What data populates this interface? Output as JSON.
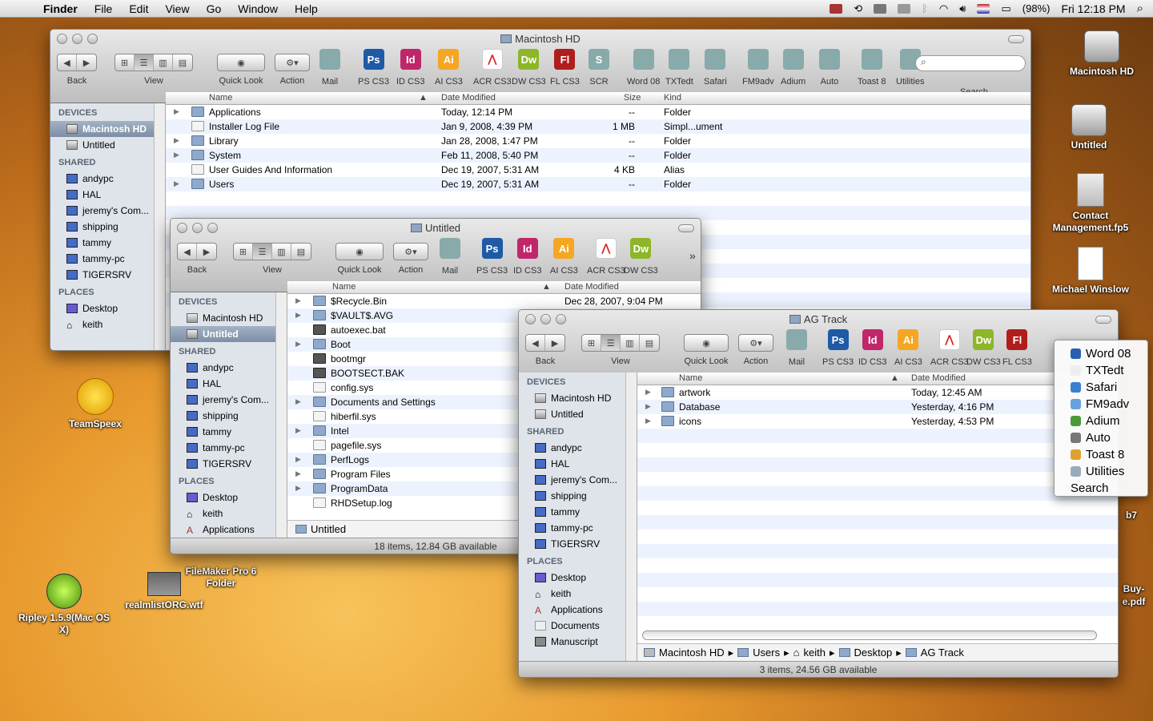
{
  "menubar": {
    "app": "Finder",
    "items": [
      "File",
      "Edit",
      "View",
      "Go",
      "Window",
      "Help"
    ],
    "battery": "(98%)",
    "clock": "Fri 12:18 PM"
  },
  "desktop": {
    "icons": [
      {
        "label": "Macintosh HD",
        "icon": "hard-drive-icon"
      },
      {
        "label": "Untitled",
        "icon": "hard-drive-icon"
      },
      {
        "label": "Contact Management.fp5",
        "icon": "filemaker-doc-icon"
      },
      {
        "label": "Michael Winslow",
        "icon": "rtf-doc-icon"
      },
      {
        "label": "TeamSpeex",
        "icon": "smiley-app-icon"
      },
      {
        "label": "FileMaker Pro 6 Folder",
        "icon": "folder-icon"
      },
      {
        "label": "Ripley 1.5.9(Mac OS X)",
        "icon": "alien-app-icon"
      },
      {
        "label": "realmlistORG.wtf",
        "icon": "document-icon"
      }
    ],
    "partial": {
      "b7": "b7",
      "buy": "Buy-",
      "pdf": "e.pdf"
    }
  },
  "common": {
    "back": "Back",
    "view": "View",
    "quicklook": "Quick Look",
    "action": "Action",
    "search": "Search"
  },
  "sidebar": {
    "devices": "DEVICES",
    "shared": "SHARED",
    "places": "PLACES",
    "device_items": [
      "Macintosh HD",
      "Untitled"
    ],
    "shared_items": [
      "andypc",
      "HAL",
      "jeremy's Com...",
      "shipping",
      "tammy",
      "tammy-pc",
      "TIGERSRV"
    ],
    "places_w1": [
      "Desktop",
      "keith"
    ],
    "places_w2": [
      "Desktop",
      "keith",
      "Applications"
    ],
    "places_w3": [
      "Desktop",
      "keith",
      "Applications",
      "Documents",
      "Manuscript"
    ]
  },
  "win1": {
    "title": "Macintosh HD",
    "tools": [
      "Mail",
      "PS CS3",
      "ID CS3",
      "AI CS3",
      "ACR CS3",
      "DW CS3",
      "FL CS3",
      "SCR",
      "Word 08",
      "TXTedt",
      "Safari",
      "FM9adv",
      "Adium",
      "Auto",
      "Toast 8",
      "Utilities"
    ],
    "columns": {
      "name": "Name",
      "date": "Date Modified",
      "size": "Size",
      "kind": "Kind"
    },
    "rows": [
      {
        "name": "Applications",
        "date": "Today, 12:14 PM",
        "size": "--",
        "kind": "Folder"
      },
      {
        "name": "Installer Log File",
        "date": "Jan 9, 2008, 4:39 PM",
        "size": "1 MB",
        "kind": "Simpl...ument"
      },
      {
        "name": "Library",
        "date": "Jan 28, 2008, 1:47 PM",
        "size": "--",
        "kind": "Folder"
      },
      {
        "name": "System",
        "date": "Feb 11, 2008, 5:40 PM",
        "size": "--",
        "kind": "Folder"
      },
      {
        "name": "User Guides And Information",
        "date": "Dec 19, 2007, 5:31 AM",
        "size": "4 KB",
        "kind": "Alias"
      },
      {
        "name": "Users",
        "date": "Dec 19, 2007, 5:31 AM",
        "size": "--",
        "kind": "Folder"
      }
    ]
  },
  "win2": {
    "title": "Untitled",
    "tools": [
      "Mail",
      "PS CS3",
      "ID CS3",
      "AI CS3",
      "ACR CS3",
      "DW CS3"
    ],
    "columns": {
      "name": "Name",
      "date": "Date Modified"
    },
    "rows": [
      "$Recycle.Bin",
      "$VAULT$.AVG",
      "autoexec.bat",
      "Boot",
      "bootmgr",
      "BOOTSECT.BAK",
      "config.sys",
      "Documents and Settings",
      "hiberfil.sys",
      "Intel",
      "pagefile.sys",
      "PerfLogs",
      "Program Files",
      "ProgramData",
      "RHDSetup.log"
    ],
    "first_date": "Dec 28, 2007, 9:04 PM",
    "path": "Untitled",
    "status": "18 items, 12.84 GB available"
  },
  "win3": {
    "title": "AG Track",
    "tools": [
      "Mail",
      "PS CS3",
      "ID CS3",
      "AI CS3",
      "ACR CS3",
      "DW CS3",
      "FL CS3"
    ],
    "columns": {
      "name": "Name",
      "date": "Date Modified"
    },
    "rows": [
      {
        "name": "artwork",
        "date": "Today, 12:45 AM"
      },
      {
        "name": "Database",
        "date": "Yesterday, 4:16 PM"
      },
      {
        "name": "icons",
        "date": "Yesterday, 4:53 PM"
      }
    ],
    "path": [
      "Macintosh HD",
      "Users",
      "keith",
      "Desktop",
      "AG Track"
    ],
    "status": "3 items, 24.56 GB available"
  },
  "overflow_menu": [
    "Word 08",
    "TXTedt",
    "Safari",
    "FM9adv",
    "Adium",
    "Auto",
    "Toast 8",
    "Utilities",
    "Search"
  ],
  "colors": {
    "ps": "#1e5aa6",
    "id": "#c0266a",
    "ai": "#f5a623",
    "acr": "#d22",
    "dw": "#8db62a",
    "fl": "#b01d1d"
  }
}
